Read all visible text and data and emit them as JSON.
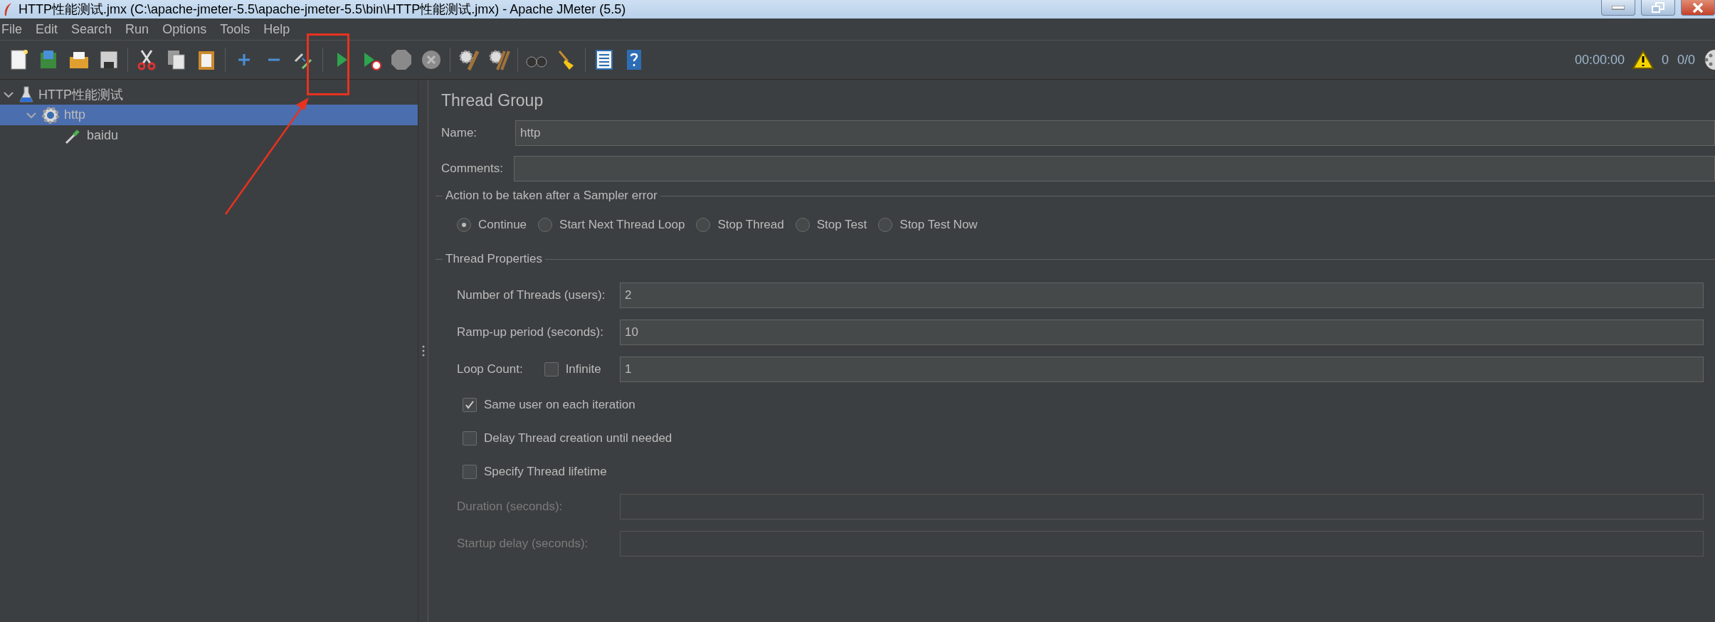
{
  "window": {
    "title": "HTTP性能测试.jmx (C:\\apache-jmeter-5.5\\apache-jmeter-5.5\\bin\\HTTP性能测试.jmx) - Apache JMeter (5.5)"
  },
  "menu": [
    {
      "label": "File"
    },
    {
      "label": "Edit"
    },
    {
      "label": "Search"
    },
    {
      "label": "Run"
    },
    {
      "label": "Options"
    },
    {
      "label": "Tools"
    },
    {
      "label": "Help"
    }
  ],
  "status": {
    "timer": "00:00:00",
    "warnings": "0",
    "threads": "0/0"
  },
  "tree": [
    {
      "label": "HTTP性能测试",
      "kind": "plan",
      "expanded": true,
      "selected": false,
      "children": [
        {
          "label": "http",
          "kind": "group",
          "expanded": true,
          "selected": true,
          "children": [
            {
              "label": "baidu",
              "kind": "sampler",
              "selected": false
            }
          ]
        }
      ]
    }
  ],
  "panel": {
    "title": "Thread Group",
    "name_label": "Name:",
    "name_value": "http",
    "comments_label": "Comments:",
    "error_group": {
      "title": "Action to be taken after a Sampler error",
      "options": [
        {
          "label": "Continue",
          "selected": true
        },
        {
          "label": "Start Next Thread Loop",
          "selected": false
        },
        {
          "label": "Stop Thread",
          "selected": false
        },
        {
          "label": "Stop Test",
          "selected": false
        },
        {
          "label": "Stop Test Now",
          "selected": false
        }
      ]
    },
    "properties": {
      "title": "Thread Properties",
      "threads": {
        "label": "Number of Threads (users):",
        "value": "2"
      },
      "rampup": {
        "label": "Ramp-up period (seconds):",
        "value": "10"
      },
      "loop": {
        "label": "Loop Count:",
        "infinite_label": "Infinite",
        "infinite_checked": false,
        "value": "1"
      },
      "options": [
        {
          "label": "Same user on each iteration",
          "checked": true
        },
        {
          "label": "Delay Thread creation until needed",
          "checked": false
        },
        {
          "label": "Specify Thread lifetime",
          "checked": false
        }
      ],
      "lifetime": [
        {
          "label": "Duration (seconds):",
          "disabled": true
        },
        {
          "label": "Startup delay (seconds):",
          "disabled": true
        }
      ]
    }
  }
}
